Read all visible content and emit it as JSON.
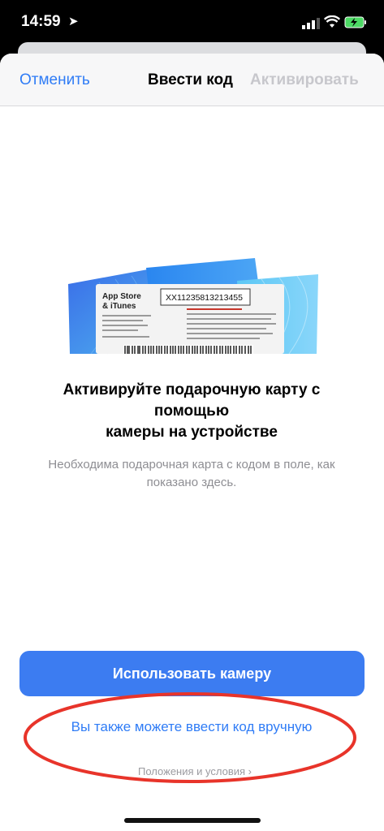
{
  "status": {
    "time": "14:59"
  },
  "nav": {
    "cancel": "Отменить",
    "title": "Ввести код",
    "activate": "Активировать"
  },
  "card": {
    "brand_line1": "App Store",
    "brand_line2": "& iTunes",
    "code": "XX11235813213455"
  },
  "main": {
    "headline_1": "Активируйте подарочную карту с",
    "headline_2": "помощью",
    "headline_3": "камеры на устройстве",
    "subtext_1": "Необходима подарочная карта с кодом в поле, как",
    "subtext_2": "показано здесь.",
    "camera_button": "Использовать камеру",
    "manual_link": "Вы также можете ввести код вручную",
    "terms": "Положения и условия ›"
  },
  "colors": {
    "accent": "#2f7cf6",
    "button": "#3c7cf1",
    "annotation": "#e8342a"
  }
}
